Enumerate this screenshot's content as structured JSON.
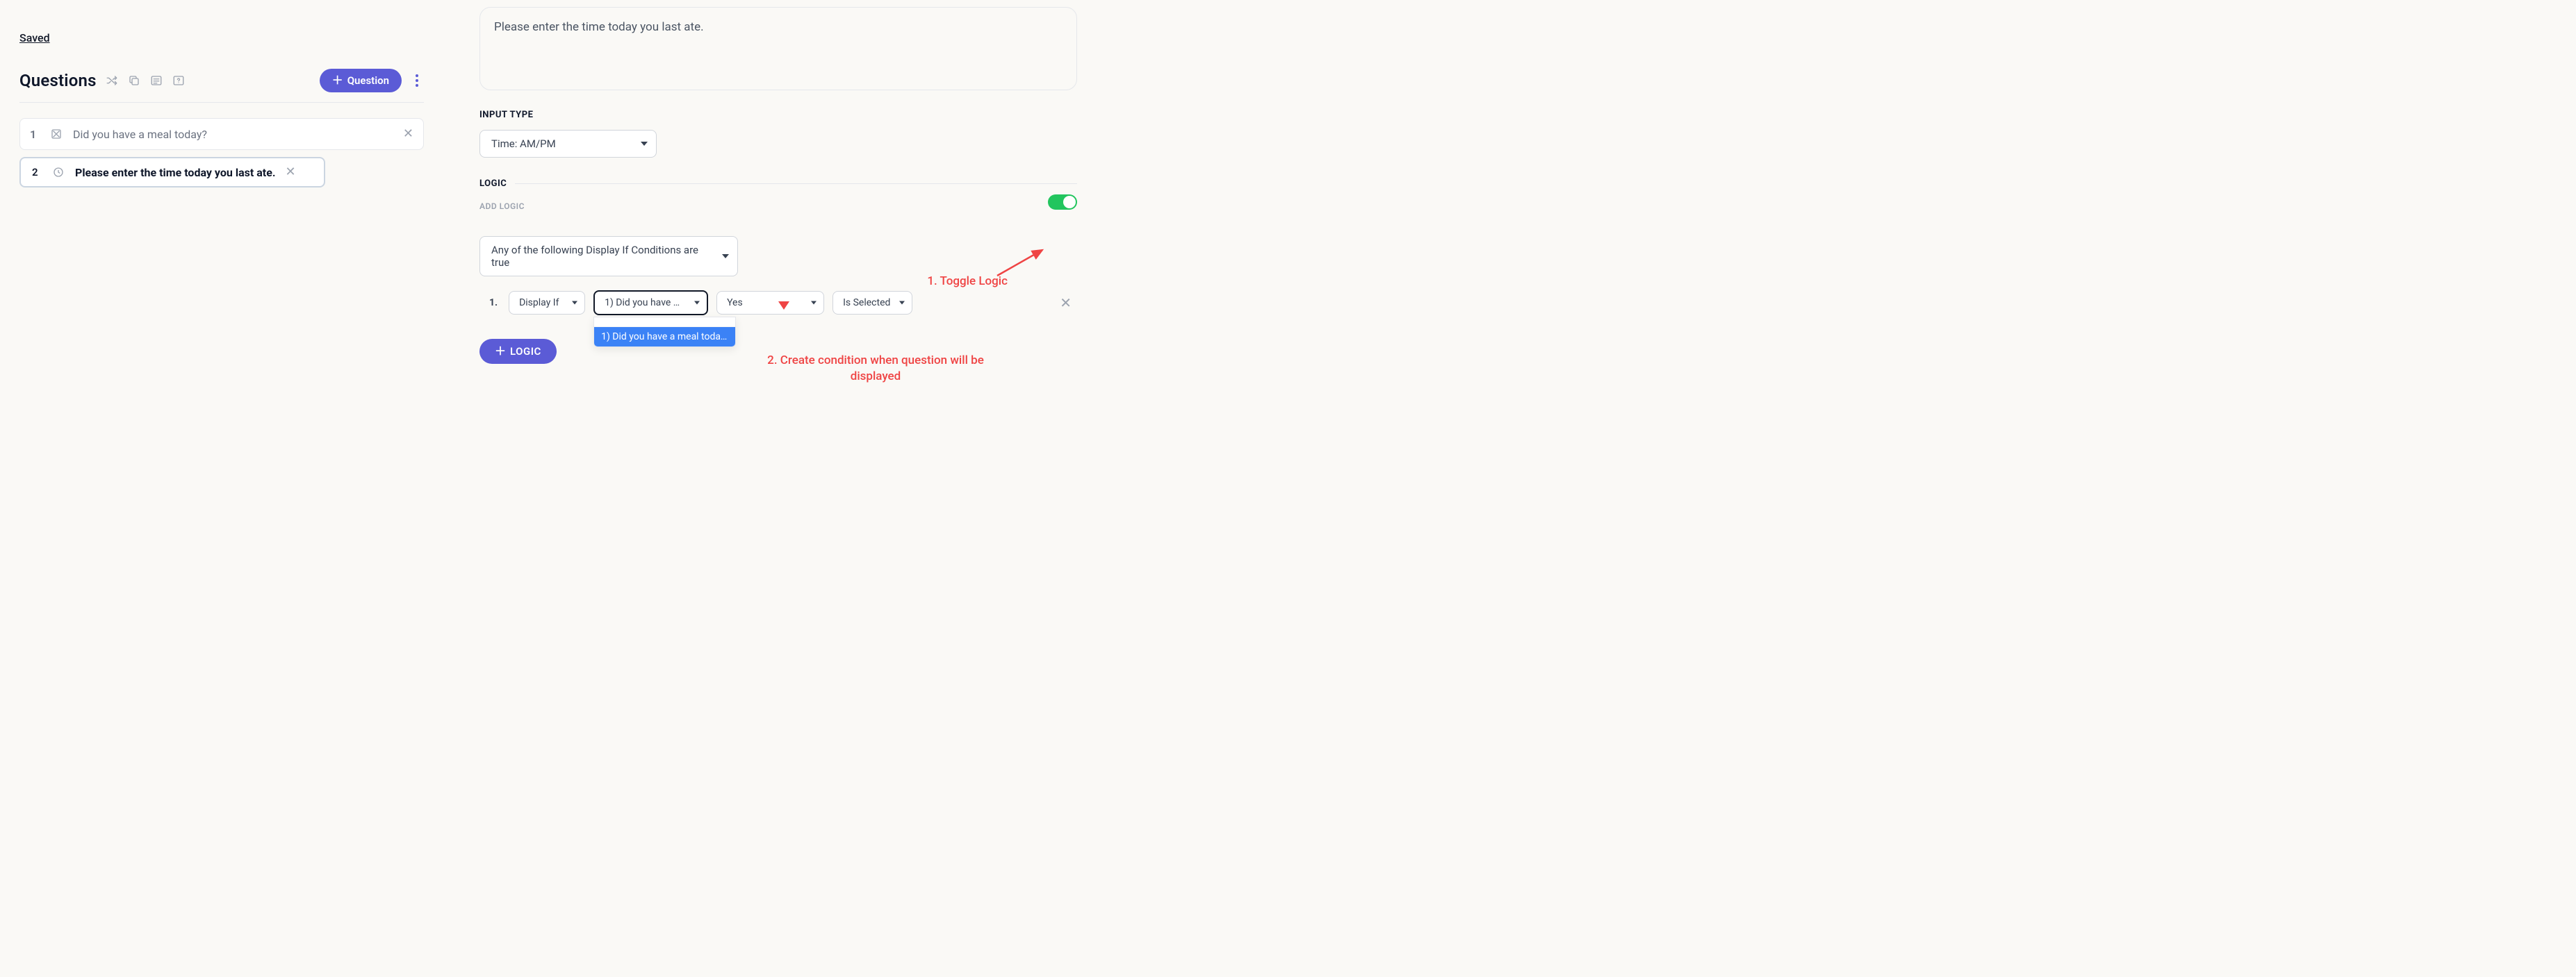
{
  "saved_label": "Saved",
  "questions_title": "Questions",
  "add_question_label": "Question",
  "questions": [
    {
      "index": "1",
      "text": "Did you have a meal today?"
    },
    {
      "index": "2",
      "text": "Please enter the time today you last ate."
    }
  ],
  "prompt_text": "Please enter the time today you last ate.",
  "input_type_label": "INPUT TYPE",
  "input_type_value": "Time: AM/PM",
  "logic_label": "LOGIC",
  "add_logic_label": "ADD LOGIC",
  "condition_mode": "Any of the following Display If Conditions are true",
  "condition": {
    "number": "1.",
    "action": "Display If",
    "question": "1) Did you have a m…",
    "value": "Yes",
    "op": "Is Selected"
  },
  "dropdown_option": "1) Did you have a meal today?",
  "logic_button_label": "LOGIC",
  "annotations": {
    "toggle": "1. Toggle Logic",
    "condition": "2. Create condition when question will be displayed"
  },
  "colors": {
    "violet": "#5b5bd6",
    "green": "#22c55e",
    "red": "#ef4444",
    "highlight": "#3b82f6"
  }
}
